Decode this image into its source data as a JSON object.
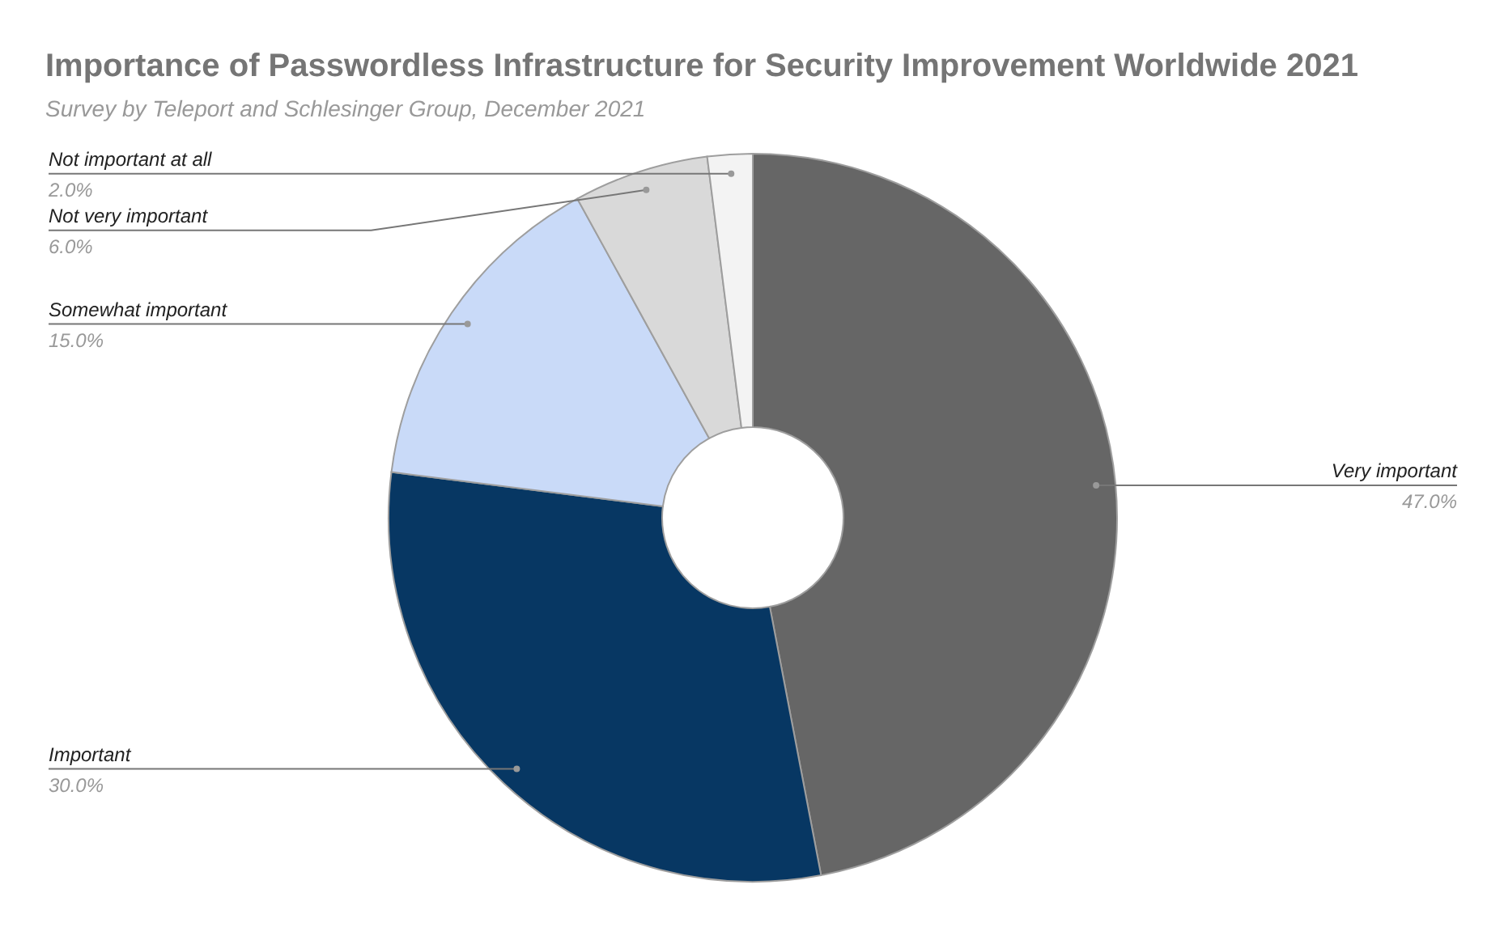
{
  "chart_data": {
    "type": "donut",
    "title": "Importance of Passwordless Infrastructure for Security Improvement Worldwide 2021",
    "categories": [
      "Very important",
      "Important",
      "Somewhat important",
      "Not very important",
      "Not important at all"
    ],
    "values": [
      47,
      30,
      15,
      6,
      2
    ],
    "colors": [
      "#666666",
      "#073763",
      "#c9daf8",
      "#d9d9d9",
      "#f3f3f3"
    ],
    "value_labels": [
      "47.0%",
      "30.0%",
      "15.0%",
      "6.0%",
      "2.0%"
    ]
  },
  "subtitle": "Survey by Teleport and Schlesinger Group, December 2021"
}
